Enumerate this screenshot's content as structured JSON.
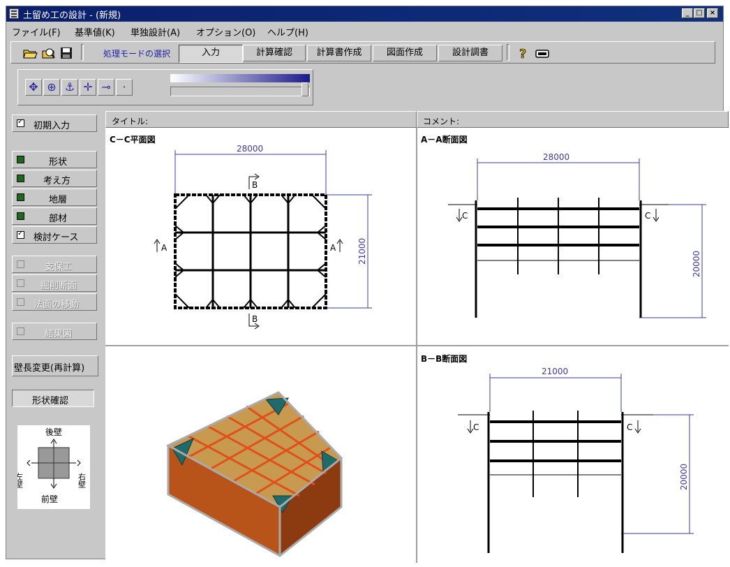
{
  "window": {
    "title": "土留め工の設計 - (新規)",
    "controls": {
      "minimize": "_",
      "maximize": "□",
      "close": "×"
    }
  },
  "menu": [
    "ファイル(F)",
    "基準値(K)",
    "単独設計(A)",
    "オプション(O)",
    "ヘルプ(H)"
  ],
  "toolbar": {
    "icons": [
      "open-folder-icon",
      "print-preview-icon",
      "save-icon"
    ],
    "mode_label": "処理モードの選択",
    "modes": [
      "入力",
      "計算確認",
      "計算書作成",
      "図面作成",
      "設計調書"
    ],
    "active_mode": "入力",
    "help_icons": [
      "help-icon",
      "keyboard-icon"
    ]
  },
  "view_toolbar": {
    "buttons": [
      "rotate-icon",
      "zoom-icon",
      "anchor-icon",
      "move-icon",
      "pan-icon",
      "dot-icon"
    ]
  },
  "sidebar": {
    "initial": {
      "label": "初期入力",
      "checked": true
    },
    "items": [
      {
        "label": "形状",
        "checked": false,
        "enabled": true
      },
      {
        "label": "考え方",
        "checked": false,
        "enabled": true
      },
      {
        "label": "地層",
        "checked": false,
        "enabled": true
      },
      {
        "label": "部材",
        "checked": false,
        "enabled": true
      },
      {
        "label": "検討ケース",
        "checked": true,
        "enabled": true
      }
    ],
    "disabled_items": [
      "支保工",
      "掘削断面",
      "法面の移動"
    ],
    "disabled_item_2": "結果図",
    "recalc_button": "壁長変更(再計算)",
    "shape_check": "形状確認",
    "wall_diagram": {
      "back": "後壁",
      "left": "左壁",
      "right": "右壁",
      "front": "前壁"
    }
  },
  "header": {
    "title_label": "タイトル:",
    "comment_label": "コメント:"
  },
  "panels": {
    "plan": {
      "title": "C－C平面図",
      "width": "28000",
      "height": "21000",
      "marks": [
        "A",
        "A",
        "B",
        "B"
      ]
    },
    "section_aa": {
      "title": "A－A断面図",
      "width": "28000",
      "depth": "20000",
      "marks": [
        "C",
        "C"
      ]
    },
    "section_bb": {
      "title": "B－B断面図",
      "width": "21000",
      "depth": "20000",
      "marks": [
        "C",
        "C"
      ]
    }
  },
  "colors": {
    "titlebar": "#0a1f6e",
    "dim": "#3a3aa0",
    "soil": "#b8541a",
    "frame": "#d86a2a",
    "waler": "#1f6a6a"
  }
}
